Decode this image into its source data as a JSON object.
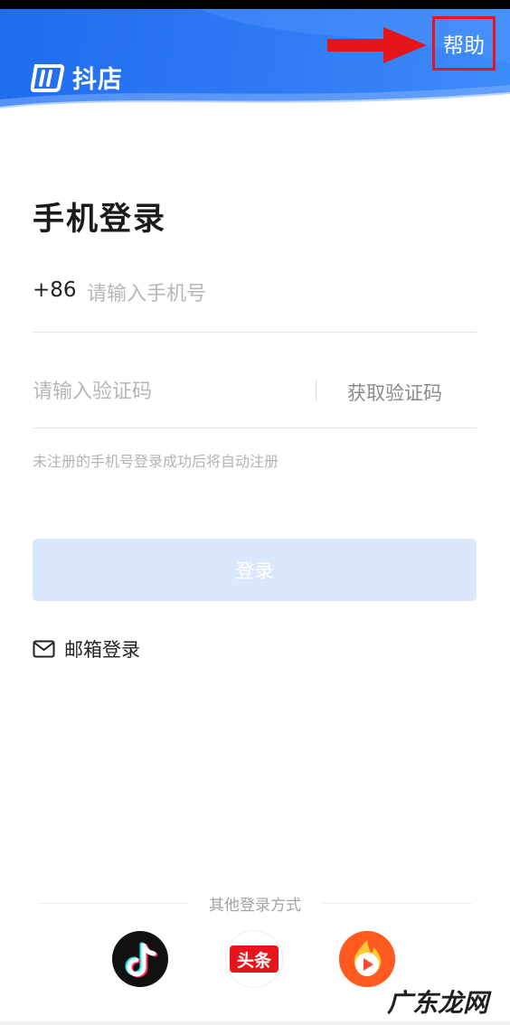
{
  "header": {
    "app_name": "抖店",
    "help_label": "帮助"
  },
  "login": {
    "title": "手机登录",
    "country_code": "+86",
    "phone_placeholder": "请输入手机号",
    "code_placeholder": "请输入验证码",
    "get_code_label": "获取验证码",
    "hint": "未注册的手机号登录成功后将自动注册",
    "submit_label": "登录",
    "email_login_label": "邮箱登录"
  },
  "other_login": {
    "label": "其他登录方式",
    "providers": [
      {
        "icon": "douyin-icon"
      },
      {
        "icon": "toutiao-icon",
        "badge_text": "头条"
      },
      {
        "icon": "xigua-icon"
      }
    ]
  },
  "watermark": "广东龙网",
  "colors": {
    "brand_blue": "#1f6cf0",
    "button_disabled": "#dbe8fb",
    "highlight_red": "#e8141b"
  }
}
